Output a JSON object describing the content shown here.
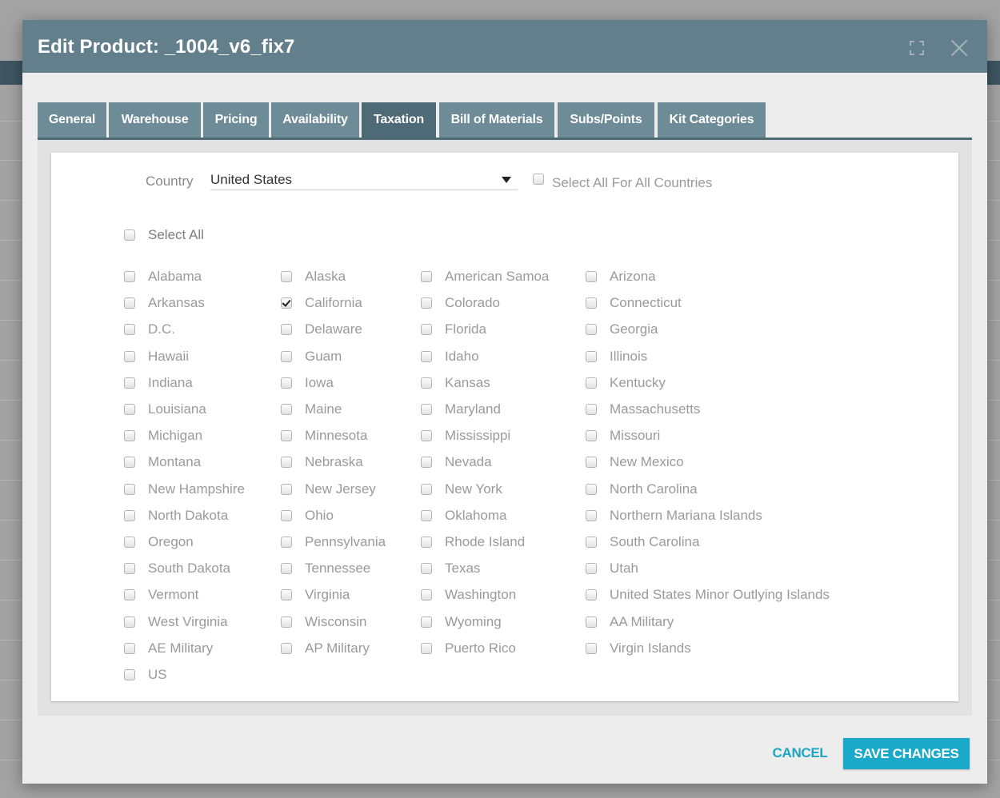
{
  "modal": {
    "title": "Edit Product: _1004_v6_fix7"
  },
  "tabs": [
    {
      "label": "General",
      "active": false
    },
    {
      "label": "Warehouse",
      "active": false
    },
    {
      "label": "Pricing",
      "active": false
    },
    {
      "label": "Availability",
      "active": false
    },
    {
      "label": "Taxation",
      "active": true
    },
    {
      "label": "Bill of Materials",
      "active": false
    },
    {
      "label": "Subs/Points",
      "active": false
    },
    {
      "label": "Kit Categories",
      "active": false
    }
  ],
  "country": {
    "label": "Country",
    "value": "United States"
  },
  "select_all_countries": {
    "label": "Select All For All Countries",
    "checked": false
  },
  "select_all": {
    "label": "Select All",
    "checked": false
  },
  "states": [
    [
      {
        "label": "Alabama",
        "checked": false
      },
      {
        "label": "Arkansas",
        "checked": false
      },
      {
        "label": "D.C.",
        "checked": false
      },
      {
        "label": "Hawaii",
        "checked": false
      },
      {
        "label": "Indiana",
        "checked": false
      },
      {
        "label": "Louisiana",
        "checked": false
      },
      {
        "label": "Michigan",
        "checked": false
      },
      {
        "label": "Montana",
        "checked": false
      },
      {
        "label": "New Hampshire",
        "checked": false
      },
      {
        "label": "North Dakota",
        "checked": false
      },
      {
        "label": "Oregon",
        "checked": false
      },
      {
        "label": "South Dakota",
        "checked": false
      },
      {
        "label": "Vermont",
        "checked": false
      },
      {
        "label": "West Virginia",
        "checked": false
      },
      {
        "label": "AE Military",
        "checked": false
      },
      {
        "label": "US",
        "checked": false
      }
    ],
    [
      {
        "label": "Alaska",
        "checked": false
      },
      {
        "label": "California",
        "checked": true
      },
      {
        "label": "Delaware",
        "checked": false
      },
      {
        "label": "Guam",
        "checked": false
      },
      {
        "label": "Iowa",
        "checked": false
      },
      {
        "label": "Maine",
        "checked": false
      },
      {
        "label": "Minnesota",
        "checked": false
      },
      {
        "label": "Nebraska",
        "checked": false
      },
      {
        "label": "New Jersey",
        "checked": false
      },
      {
        "label": "Ohio",
        "checked": false
      },
      {
        "label": "Pennsylvania",
        "checked": false
      },
      {
        "label": "Tennessee",
        "checked": false
      },
      {
        "label": "Virginia",
        "checked": false
      },
      {
        "label": "Wisconsin",
        "checked": false
      },
      {
        "label": "AP Military",
        "checked": false
      }
    ],
    [
      {
        "label": "American Samoa",
        "checked": false
      },
      {
        "label": "Colorado",
        "checked": false
      },
      {
        "label": "Florida",
        "checked": false
      },
      {
        "label": "Idaho",
        "checked": false
      },
      {
        "label": "Kansas",
        "checked": false
      },
      {
        "label": "Maryland",
        "checked": false
      },
      {
        "label": "Mississippi",
        "checked": false
      },
      {
        "label": "Nevada",
        "checked": false
      },
      {
        "label": "New York",
        "checked": false
      },
      {
        "label": "Oklahoma",
        "checked": false
      },
      {
        "label": "Rhode Island",
        "checked": false
      },
      {
        "label": "Texas",
        "checked": false
      },
      {
        "label": "Washington",
        "checked": false
      },
      {
        "label": "Wyoming",
        "checked": false
      },
      {
        "label": "Puerto Rico",
        "checked": false
      }
    ],
    [
      {
        "label": "Arizona",
        "checked": false
      },
      {
        "label": "Connecticut",
        "checked": false
      },
      {
        "label": "Georgia",
        "checked": false
      },
      {
        "label": "Illinois",
        "checked": false
      },
      {
        "label": "Kentucky",
        "checked": false
      },
      {
        "label": "Massachusetts",
        "checked": false
      },
      {
        "label": "Missouri",
        "checked": false
      },
      {
        "label": "New Mexico",
        "checked": false
      },
      {
        "label": "North Carolina",
        "checked": false
      },
      {
        "label": "Northern Mariana Islands",
        "checked": false
      },
      {
        "label": "South Carolina",
        "checked": false
      },
      {
        "label": "Utah",
        "checked": false
      },
      {
        "label": "United States Minor Outlying Islands",
        "checked": false
      },
      {
        "label": "AA Military",
        "checked": false
      },
      {
        "label": "Virgin Islands",
        "checked": false
      }
    ]
  ],
  "footer": {
    "cancel_label": "CANCEL",
    "save_label": "SAVE CHANGES"
  },
  "colors": {
    "header": "#647f8c",
    "tab": "#6e8b98",
    "tab_active": "#4f6a77",
    "accent": "#1aa9c8"
  }
}
